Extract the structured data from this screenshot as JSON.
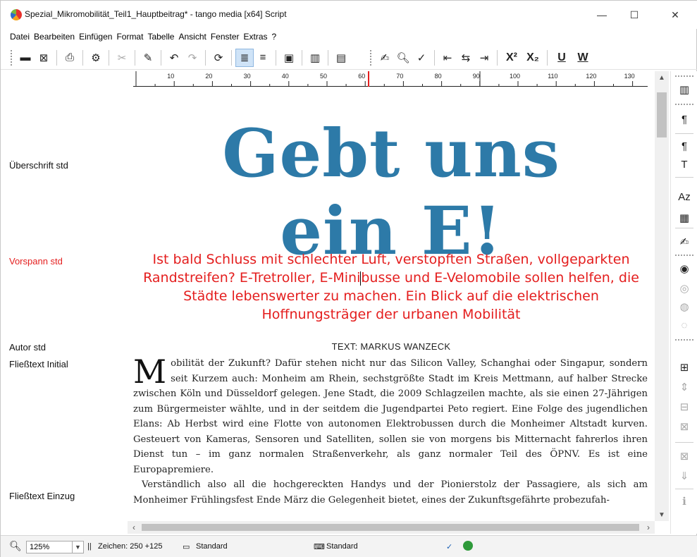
{
  "window": {
    "title": "Spezial_Mikromobilität_Teil1_Hauptbeitrag* - tango media [x64] Script",
    "minimize": "—",
    "maximize": "☐",
    "close": "✕"
  },
  "menu": [
    "Datei",
    "Bearbeiten",
    "Einfügen",
    "Format",
    "Tabelle",
    "Ansicht",
    "Fenster",
    "Extras",
    "?"
  ],
  "toolbar": {
    "superscript": "X²",
    "subscript": "X₂",
    "underline": "U",
    "word_underline": "W"
  },
  "styles": {
    "headline": "Überschrift std",
    "lead": "Vorspann std",
    "author": "Autor std",
    "body_initial": "Fließtext Initial",
    "body_indent": "Fließtext Einzug"
  },
  "ruler": {
    "ticks": [
      "10",
      "20",
      "30",
      "40",
      "50",
      "60",
      "70",
      "80",
      "90",
      "100",
      "110",
      "120",
      "130"
    ]
  },
  "document": {
    "headline_line1": "Gebt uns",
    "headline_line2": "ein E!",
    "lead_part1": "Ist bald Schluss mit schlechter Luft, verstopften Straßen, vollgeparkten Randstreifen? E-Tretroller, E-Mini",
    "lead_part2": "busse und E-Velomobile sollen helfen, die Städte lebenswerter zu machen. Ein Blick auf die elektrischen Hoffnungsträger der urbanen Mobilität",
    "author": "TEXT: MARKUS WANZECK",
    "dropcap": "M",
    "para1": "obilität der Zukunft? Dafür stehen nicht nur das Silicon Valley, Schanghai oder Singapur, sondern seit Kurzem auch: Monheim am Rhein, sechstgrößte Stadt im Kreis Mettmann, auf halber Strecke zwischen Köln und Düsseldorf gelegen. Jene Stadt, die 2009 Schlagzeilen machte, als sie einen 27-Jährigen zum Bürgermeister wählte, und in der seitdem die Jugendpartei Peto regiert. Eine Folge des jugendlichen Elans: Ab Herbst wird eine Flotte von autonomen Elektrobussen durch die Monheimer Altstadt kurven. Gesteuert von Kameras, Sensoren und Satelliten, sollen sie von morgens bis Mitternacht fahrerlos ihren Dienst tun – im ganz normalen Straßenverkehr, als ganz normaler Teil des ÖPNV. Es ist eine Europapremiere.",
    "para2": "Verständlich also all die hochgereckten Handys und der Pionierstolz der Passagiere, als sich am Monheimer Frühlingsfest Ende März die Gelegenheit bietet, eines der Zukunftsgefährte probezufah-"
  },
  "statusbar": {
    "zoom": "125%",
    "chars": "Zeichen: 250 +125",
    "mode1": "Standard",
    "mode2": "Standard"
  }
}
